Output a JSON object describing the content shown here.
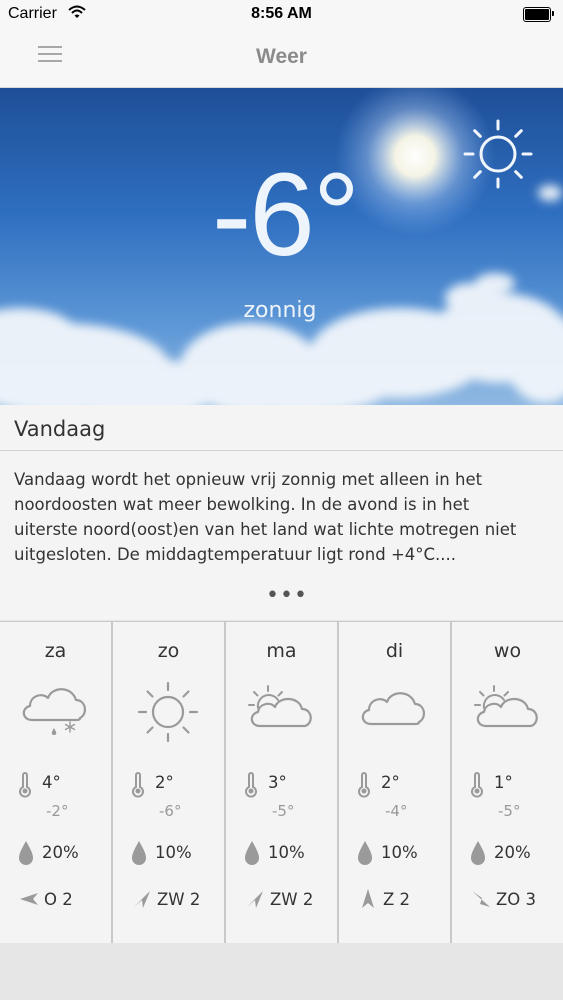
{
  "status_bar": {
    "carrier": "Carrier",
    "time": "8:56 AM"
  },
  "nav": {
    "title": "Weer",
    "menu_icon": "hamburger-icon"
  },
  "hero": {
    "temperature": "-6°",
    "condition": "zonnig",
    "icon": "sun-icon"
  },
  "today": {
    "heading": "Vandaag",
    "text": "Vandaag wordt het opnieuw vrij zonnig met alleen in het noordoosten wat meer bewolking. In de avond is in het uiterste noord(oost)en van het land wat lichte motregen niet uitgesloten. De middagtemperatuur ligt rond +4°C....",
    "more": "•••"
  },
  "days": [
    {
      "name": "za",
      "icon": "cloud-rain-snow-icon",
      "max": "4°",
      "min": "-2°",
      "rain": "20%",
      "wind": "O 2",
      "wind_dir": "O"
    },
    {
      "name": "zo",
      "icon": "sun-icon",
      "max": "2°",
      "min": "-6°",
      "rain": "10%",
      "wind": "ZW 2",
      "wind_dir": "ZW"
    },
    {
      "name": "ma",
      "icon": "sun-cloud-icon",
      "max": "3°",
      "min": "-5°",
      "rain": "10%",
      "wind": "ZW 2",
      "wind_dir": "ZW"
    },
    {
      "name": "di",
      "icon": "cloud-icon",
      "max": "2°",
      "min": "-4°",
      "rain": "10%",
      "wind": "Z 2",
      "wind_dir": "Z"
    },
    {
      "name": "wo",
      "icon": "sun-cloud-icon",
      "max": "1°",
      "min": "-5°",
      "rain": "20%",
      "wind": "ZO 3",
      "wind_dir": "ZO"
    }
  ],
  "colors": {
    "icon_gray": "#9a9a9a",
    "sky_top": "#1e4f98",
    "sky_bottom": "#8fb8e2"
  }
}
